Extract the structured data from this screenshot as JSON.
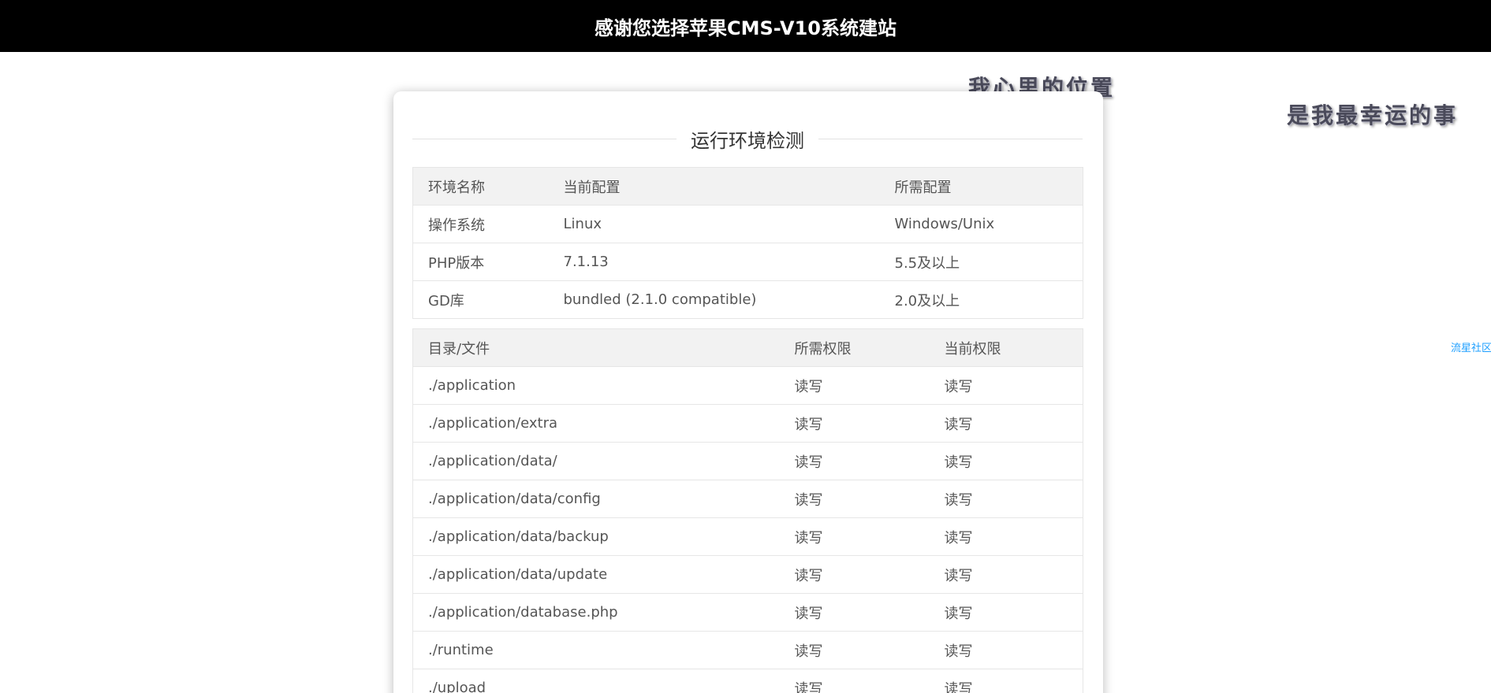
{
  "header": {
    "title": "感谢您选择苹果CMS-V10系统建站"
  },
  "decorations": {
    "text1": "我心里的位置",
    "text2": "是我最幸运的事"
  },
  "side_link": {
    "label": "流星社区"
  },
  "section": {
    "title": "运行环境检测"
  },
  "env_table": {
    "headers": [
      "环境名称",
      "当前配置",
      "所需配置"
    ],
    "rows": [
      [
        "操作系统",
        "Linux",
        "Windows/Unix"
      ],
      [
        "PHP版本",
        "7.1.13",
        "5.5及以上"
      ],
      [
        "GD库",
        "bundled (2.1.0 compatible)",
        "2.0及以上"
      ]
    ]
  },
  "perm_table": {
    "headers": [
      "目录/文件",
      "所需权限",
      "当前权限"
    ],
    "rows": [
      [
        "./application",
        "读写",
        "读写"
      ],
      [
        "./application/extra",
        "读写",
        "读写"
      ],
      [
        "./application/data/",
        "读写",
        "读写"
      ],
      [
        "./application/data/config",
        "读写",
        "读写"
      ],
      [
        "./application/data/backup",
        "读写",
        "读写"
      ],
      [
        "./application/data/update",
        "读写",
        "读写"
      ],
      [
        "./application/database.php",
        "读写",
        "读写"
      ],
      [
        "./runtime",
        "读写",
        "读写"
      ],
      [
        "./upload",
        "读写",
        "读写"
      ]
    ]
  }
}
